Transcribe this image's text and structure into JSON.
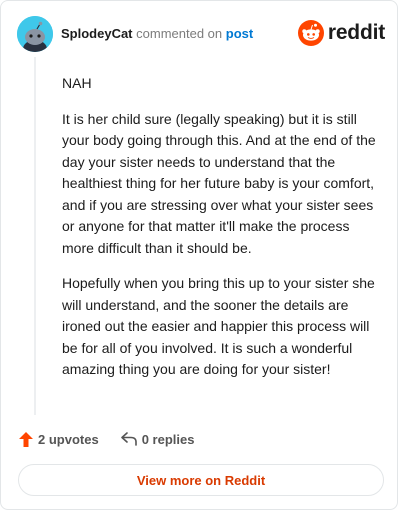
{
  "header": {
    "username": "SplodeyCat",
    "verb": "commented on",
    "post_link": "post",
    "brand_name": "reddit"
  },
  "comment": {
    "paragraphs": [
      "NAH",
      "It is her child sure (legally speaking) but it is still your body going through this. And at the end of the day your sister needs to understand that the healthiest thing for her future baby is your comfort, and if you are stressing over what your sister sees or anyone for that matter it'll make the process more difficult than it should be.",
      "Hopefully when you bring this up to your sister she will understand, and the sooner the details are ironed out the easier and happier this process will be for all of you involved. It is such a wonderful amazing thing you are doing for your sister!"
    ]
  },
  "actions": {
    "upvotes": "2 upvotes",
    "replies": "0 replies"
  },
  "footer": {
    "view_more": "View more on Reddit"
  },
  "colors": {
    "accent": "#d93a00",
    "upvote": "#ff4500",
    "link": "#0079d3",
    "avatar_bg": "#3fc8ea"
  },
  "icons": [
    "snoo-avatar",
    "reddit-logo-icon",
    "upvote-icon",
    "reply-icon"
  ]
}
